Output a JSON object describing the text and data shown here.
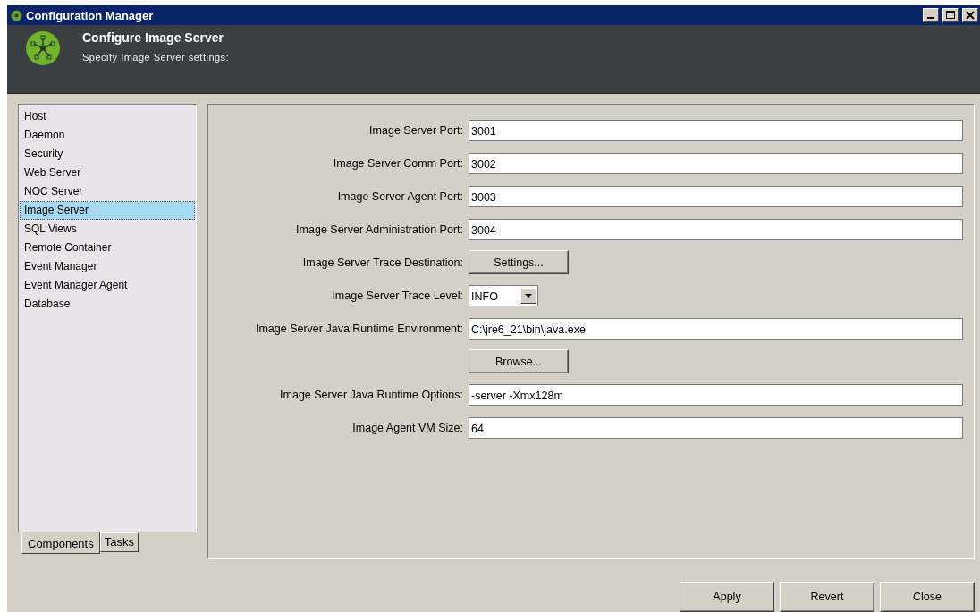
{
  "window": {
    "title": "Configuration Manager"
  },
  "header": {
    "title": "Configure Image Server",
    "subtitle": "Specify Image Server settings:"
  },
  "sidebar": {
    "items": [
      {
        "label": "Host",
        "selected": false
      },
      {
        "label": "Daemon",
        "selected": false
      },
      {
        "label": "Security",
        "selected": false
      },
      {
        "label": "Web Server",
        "selected": false
      },
      {
        "label": "NOC Server",
        "selected": false
      },
      {
        "label": "Image Server",
        "selected": true
      },
      {
        "label": "SQL Views",
        "selected": false
      },
      {
        "label": "Remote Container",
        "selected": false
      },
      {
        "label": "Event Manager",
        "selected": false
      },
      {
        "label": "Event Manager Agent",
        "selected": false
      },
      {
        "label": "Database",
        "selected": false
      }
    ],
    "tabs": [
      {
        "label": "Components",
        "selected": true
      },
      {
        "label": "Tasks",
        "selected": false
      }
    ]
  },
  "form": [
    {
      "kind": "text",
      "label": "Image Server Port:",
      "value": "3001"
    },
    {
      "kind": "text",
      "label": "Image Server Comm Port:",
      "value": "3002"
    },
    {
      "kind": "text",
      "label": "Image Server Agent Port:",
      "value": "3003"
    },
    {
      "kind": "text",
      "label": "Image Server Administration Port:",
      "value": "3004"
    },
    {
      "kind": "button",
      "label": "Image Server Trace Destination:",
      "value": "Settings..."
    },
    {
      "kind": "select",
      "label": "Image Server Trace Level:",
      "value": "INFO"
    },
    {
      "kind": "text",
      "label": "Image Server Java Runtime Environment:",
      "value": "C:\\jre6_21\\bin\\java.exe"
    },
    {
      "kind": "button",
      "value": "Browse..."
    },
    {
      "kind": "text",
      "label": "Image Server Java Runtime Options:",
      "value": "-server -Xmx128m"
    },
    {
      "kind": "text",
      "label": "Image Agent VM Size:",
      "value": "64"
    }
  ],
  "buttons": [
    "Apply",
    "Revert",
    "Close"
  ]
}
